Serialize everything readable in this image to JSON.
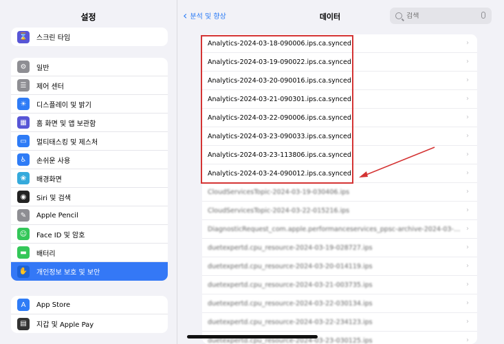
{
  "sidebar": {
    "title": "설정",
    "group1": [
      {
        "label": "스크린 타임",
        "icon": "hourglass-icon",
        "color": "#5856d6",
        "glyph": "⌛"
      }
    ],
    "group2": [
      {
        "label": "일반",
        "icon": "gear-icon",
        "color": "#8e8e93",
        "glyph": "⚙"
      },
      {
        "label": "제어 센터",
        "icon": "control-center-icon",
        "color": "#8e8e93",
        "glyph": "☰"
      },
      {
        "label": "디스플레이 및 밝기",
        "icon": "brightness-icon",
        "color": "#2f7cf6",
        "glyph": "☀"
      },
      {
        "label": "홈 화면 및 앱 보관함",
        "icon": "home-screen-icon",
        "color": "#5856d6",
        "glyph": "▦"
      },
      {
        "label": "멀티태스킹 및 제스처",
        "icon": "multitasking-icon",
        "color": "#2f7cf6",
        "glyph": "▭"
      },
      {
        "label": "손쉬운 사용",
        "icon": "accessibility-icon",
        "color": "#2f7cf6",
        "glyph": "♿"
      },
      {
        "label": "배경화면",
        "icon": "wallpaper-icon",
        "color": "#35aadc",
        "glyph": "❀"
      },
      {
        "label": "Siri 및 검색",
        "icon": "siri-icon",
        "color": "#222222",
        "glyph": "◉"
      },
      {
        "label": "Apple Pencil",
        "icon": "pencil-icon",
        "color": "#8e8e93",
        "glyph": "✎"
      },
      {
        "label": "Face ID 및 암호",
        "icon": "faceid-icon",
        "color": "#34c759",
        "glyph": "☺"
      },
      {
        "label": "배터리",
        "icon": "battery-icon",
        "color": "#34c759",
        "glyph": "▬"
      },
      {
        "label": "개인정보 보호 및 보안",
        "icon": "hand-icon",
        "color": "#2f7cf6",
        "glyph": "✋",
        "selected": true
      }
    ],
    "group3": [
      {
        "label": "App Store",
        "icon": "appstore-icon",
        "color": "#2f7cf6",
        "glyph": "A"
      },
      {
        "label": "지갑 및 Apple Pay",
        "icon": "wallet-icon",
        "color": "#333333",
        "glyph": "▤"
      }
    ]
  },
  "header": {
    "back_label": "분석 및 향상",
    "title": "데이터",
    "search_placeholder": "검색"
  },
  "files": [
    {
      "name": "Analytics-2024-03-18-090006.ips.ca.synced",
      "blurred": false
    },
    {
      "name": "Analytics-2024-03-19-090022.ips.ca.synced",
      "blurred": false
    },
    {
      "name": "Analytics-2024-03-20-090016.ips.ca.synced",
      "blurred": false
    },
    {
      "name": "Analytics-2024-03-21-090301.ips.ca.synced",
      "blurred": false
    },
    {
      "name": "Analytics-2024-03-22-090006.ips.ca.synced",
      "blurred": false
    },
    {
      "name": "Analytics-2024-03-23-090033.ips.ca.synced",
      "blurred": false
    },
    {
      "name": "Analytics-2024-03-23-113806.ips.ca.synced",
      "blurred": false
    },
    {
      "name": "Analytics-2024-03-24-090012.ips.ca.synced",
      "blurred": false
    },
    {
      "name": "CloudServicesTopic-2024-03-19-030406.ips",
      "blurred": true
    },
    {
      "name": "CloudServicesTopic-2024-03-22-015216.ips",
      "blurred": true
    },
    {
      "name": "DiagnosticRequest_com.apple.performanceservices_ppsc-archive-2024-03-23-0...",
      "blurred": true
    },
    {
      "name": "duetexpertd.cpu_resource-2024-03-19-028727.ips",
      "blurred": true
    },
    {
      "name": "duetexpertd.cpu_resource-2024-03-20-014119.ips",
      "blurred": true
    },
    {
      "name": "duetexpertd.cpu_resource-2024-03-21-003735.ips",
      "blurred": true
    },
    {
      "name": "duetexpertd.cpu_resource-2024-03-22-030134.ips",
      "blurred": true
    },
    {
      "name": "duetexpertd.cpu_resource-2024-03-22-234123.ips",
      "blurred": true
    },
    {
      "name": "duetexpertd.cpu_resource-2024-03-23-030125.ips",
      "blurred": true
    }
  ],
  "colors": {
    "accent": "#2a7bf6",
    "highlight": "#d43333",
    "selected_row": "#3478f6"
  }
}
